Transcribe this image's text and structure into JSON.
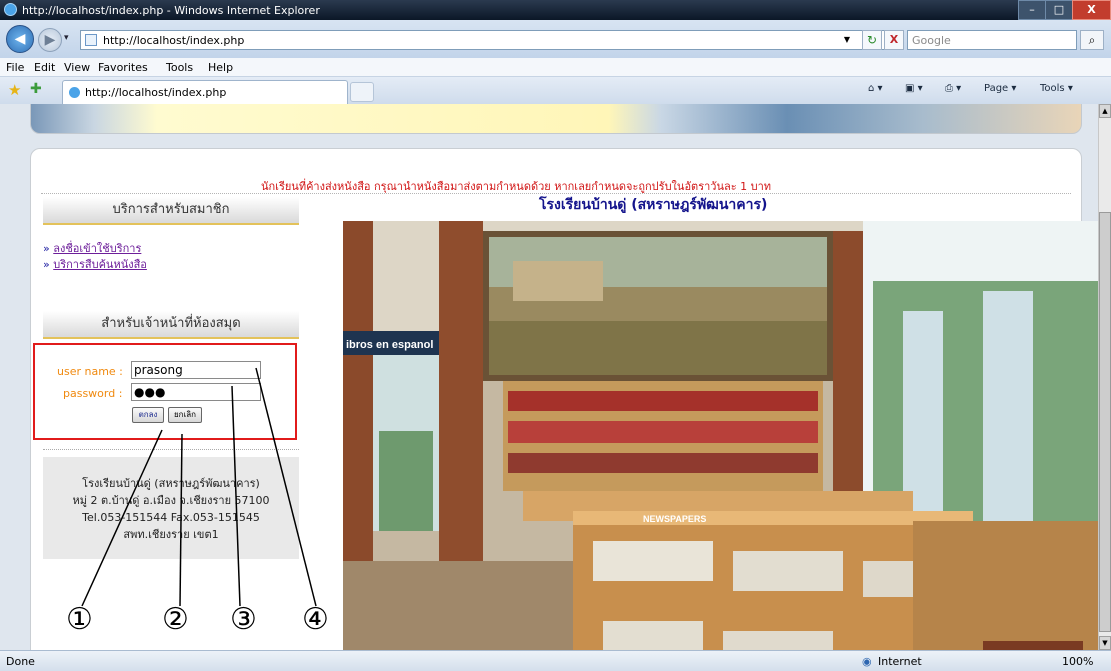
{
  "window": {
    "title": "http://localhost/index.php - Windows Internet Explorer"
  },
  "window_buttons": {
    "min": "–",
    "max": "□",
    "close": "X"
  },
  "nav": {
    "back": "◀",
    "forward": "▶",
    "history": "▾",
    "address": "http://localhost/index.php",
    "address_dropdown": "▼",
    "refresh": "↻",
    "stop": "X",
    "search_placeholder": "Google",
    "search_go": "⌕"
  },
  "menu": [
    "File",
    "Edit",
    "View",
    "Favorites",
    "Tools",
    "Help"
  ],
  "tab": {
    "label": "http://localhost/index.php",
    "favorites_star": "★",
    "add_favorites": "✚"
  },
  "command_bar": {
    "home": "⌂ ▾",
    "feeds": "▣ ▾",
    "print": "⎙ ▾",
    "page": "Page ▾",
    "tools": "Tools ▾"
  },
  "page": {
    "notice": "นักเรียนที่ค้างส่งหนังสือ กรุณานำหนังสือมาส่งตามกำหนดด้วย หากเลยกำหนดจะถูกปรับในอัตราวันละ 1 บาท",
    "school_title": "โรงเรียนบ้านดู่ (สหราษฎร์พัฒนาคาร)",
    "member_header": "บริการสำหรับสมาชิก",
    "member_links": [
      "ลงชื่อเข้าใช้บริการ",
      "บริการสืบค้นหนังสือ"
    ],
    "link_arrow": "»",
    "staff_header": "สำหรับเจ้าหน้าที่ห้องสมุด",
    "login": {
      "username_label": "user name :",
      "username_value": "prasong",
      "password_label": "password :",
      "password_value": "●●●",
      "ok_button": "ตกลง",
      "cancel_button": "ยกเลิก"
    },
    "address_lines": [
      "โรงเรียนบ้านดู่ (สหราษฎร์พัฒนาคาร)",
      "หมู่ 2 ต.บ้านดู่ อ.เมือง จ.เชียงราย 57100",
      "Tel.053-151544 Fax.053-151545",
      "สพท.เชียงราย เขต1"
    ],
    "photo_text": {
      "libros": "ibros en espanol",
      "newspapers": "NEWSPAPERS"
    }
  },
  "callouts": [
    "①",
    "②",
    "③",
    "④"
  ],
  "status": {
    "left": "Done",
    "zone": "Internet",
    "zoom": "100%"
  },
  "colors": {
    "notice": "#d11515",
    "title": "#14148c",
    "login_border": "#e11b1b",
    "label": "#f08a10",
    "link": "#6d1e9a"
  }
}
